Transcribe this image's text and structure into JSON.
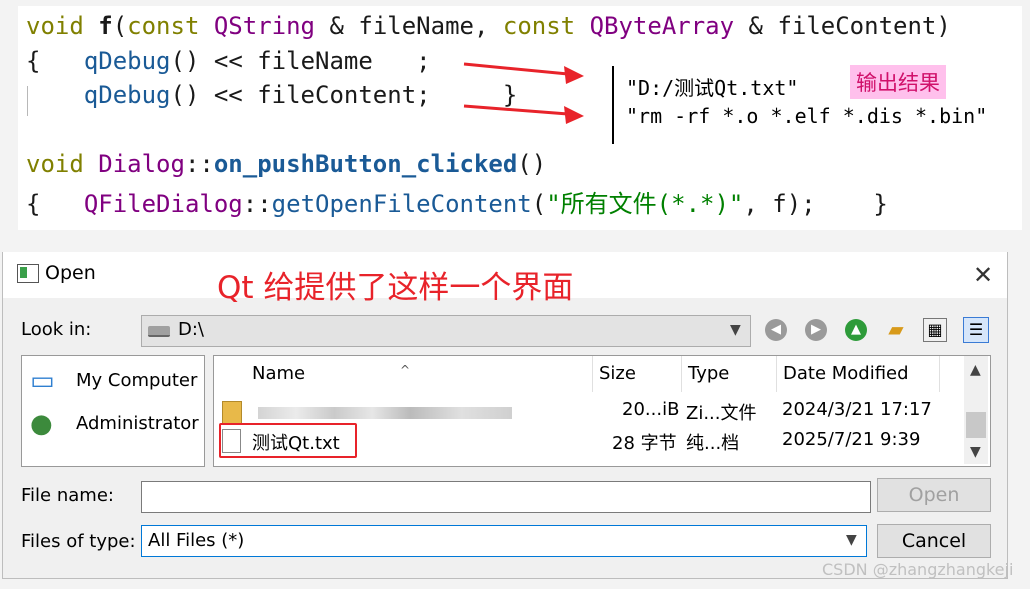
{
  "code": {
    "line1": {
      "kw": "void",
      "fn": "f",
      "p1": "(",
      "c1": "const",
      "t1": "QString",
      "amp1": " & ",
      "v1": "fileName",
      "sep": ", ",
      "c2": "const",
      "t2": "QByteArray",
      "amp2": " & ",
      "v2": "fileContent",
      "close": ")"
    },
    "line2": {
      "brace": "{",
      "call": "qDebug",
      "rest": "() << ",
      "var": "fileName",
      "semi": ";"
    },
    "line3": {
      "call": "qDebug",
      "rest": "() << ",
      "var": "fileContent",
      "semi": ";",
      "brace": "}"
    },
    "line4": {
      "kw": "void",
      "cls": "Dialog",
      "sep": "::",
      "fn": "on_pushButton_clicked",
      "paren": "()"
    },
    "line5": {
      "brace": "{",
      "cls": "QFileDialog",
      "sep": "::",
      "fn": "getOpenFileContent",
      "p1": "(",
      "str": "\"所有文件(*.*)\"",
      "rest": ", f);",
      "brace2": "}"
    }
  },
  "output": {
    "line1": "\"D:/测试Qt.txt\"",
    "line2": "\"rm -rf *.o *.elf *.dis *.bin\"",
    "tag": "输出结果"
  },
  "dialog": {
    "title": "Open",
    "annotation": "Qt 给提供了这样一个界面",
    "look_in_label": "Look in:",
    "look_in_value": "D:\\",
    "sidebar": [
      "My Computer",
      "Administrator"
    ],
    "columns": [
      "Name",
      "Size",
      "Type",
      "Date Modified"
    ],
    "rows": [
      {
        "name": "",
        "size": "20...iB",
        "type": "Zi...文件",
        "date": "2024/3/21 17:17"
      },
      {
        "name": "测试Qt.txt",
        "size": "28 字节",
        "type": "纯...档",
        "date": "2025/7/21 9:39"
      }
    ],
    "file_name_label": "File name:",
    "file_name_value": "",
    "files_of_type_label": "Files of type:",
    "files_of_type_value": "All Files (*)",
    "open_button": "Open",
    "cancel_button": "Cancel"
  },
  "watermark": "CSDN @zhangzhangkeji",
  "colors": {
    "annotation": "#e8232a",
    "tag_bg": "#ffc0ec",
    "tag_text": "#d0106a"
  }
}
